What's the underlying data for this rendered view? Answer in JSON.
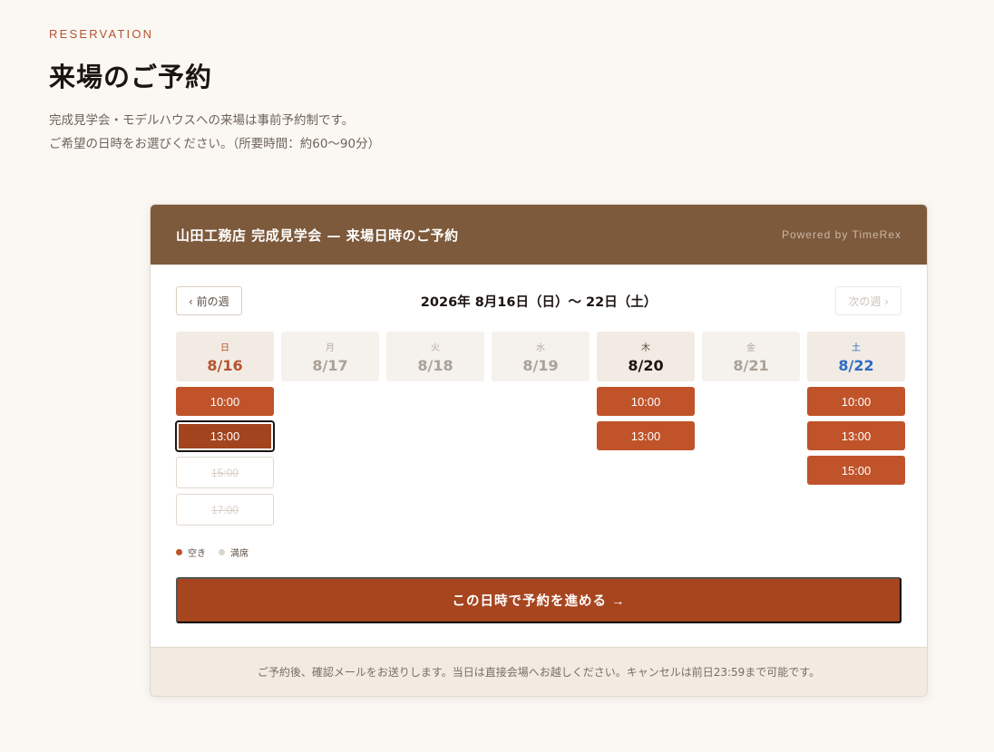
{
  "header": {
    "eyebrow": "RESERVATION",
    "title": "来場のご予約",
    "intro_line1": "完成見学会・モデルハウスへの来場は事前予約制です。",
    "intro_line2": "ご希望の日時をお選びください。（所要時間：約60〜90分）"
  },
  "widget": {
    "title": "山田工務店 完成見学会 — 来場日時のご予約",
    "powered_by": "Powered by TimeRex",
    "prev_week": "‹ 前の週",
    "next_week": "次の週 ›",
    "week_range": "2026年 8月16日（日）〜 22日（土）",
    "days": [
      {
        "dow": "日",
        "date": "8/16",
        "slots": [
          {
            "time": "10:00",
            "status": "open"
          },
          {
            "time": "13:00",
            "status": "selected"
          },
          {
            "time": "15:00",
            "status": "full"
          },
          {
            "time": "17:00",
            "status": "full"
          }
        ]
      },
      {
        "dow": "月",
        "date": "8/17",
        "slots": []
      },
      {
        "dow": "火",
        "date": "8/18",
        "slots": []
      },
      {
        "dow": "水",
        "date": "8/19",
        "slots": []
      },
      {
        "dow": "木",
        "date": "8/20",
        "slots": [
          {
            "time": "10:00",
            "status": "open"
          },
          {
            "time": "13:00",
            "status": "open"
          }
        ]
      },
      {
        "dow": "金",
        "date": "8/21",
        "slots": []
      },
      {
        "dow": "土",
        "date": "8/22",
        "slots": [
          {
            "time": "10:00",
            "status": "open"
          },
          {
            "time": "13:00",
            "status": "open"
          },
          {
            "time": "15:00",
            "status": "open"
          }
        ]
      }
    ],
    "legend": {
      "available": "空き",
      "full": "満席",
      "available_color": "#c0532a",
      "full_color": "#ddd5cb"
    },
    "cta": "この日時で予約を進める →",
    "footer_note": "ご予約後、確認メールをお送りします。当日は直接会場へお越しください。キャンセルは前日23:59まで可能です。"
  },
  "colors": {
    "accent": "#c0532a",
    "header_bg": "#7d5a3c",
    "sunday": "#b5532f",
    "saturday": "#2f6bc4"
  }
}
